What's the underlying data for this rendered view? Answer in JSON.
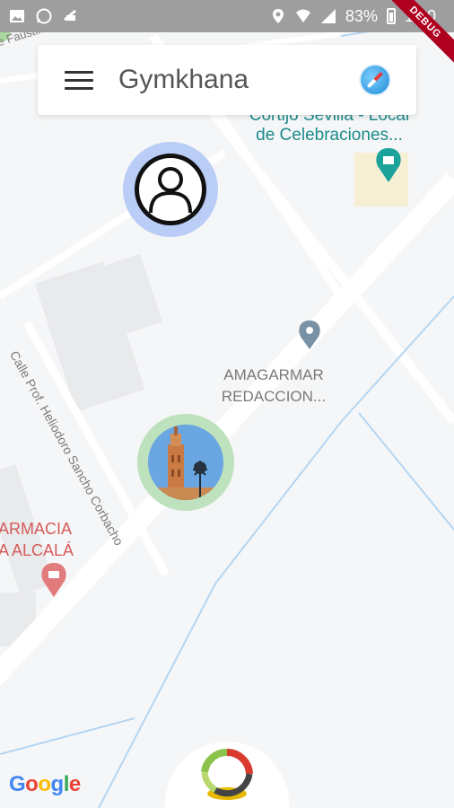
{
  "status_bar": {
    "battery": "83%",
    "time": "1:10",
    "debug": "DEBUG"
  },
  "app_bar": {
    "title": "Gymkhana",
    "menu_icon": "menu-icon",
    "compass_icon": "compass-icon"
  },
  "map": {
    "labels": {
      "street_top": "e Faustino Gutiérrez A",
      "poi_top_line1": "Cortijo Sevilla - Local",
      "poi_top_line2": "de Celebraciones...",
      "poi_mid_line1": "AMAGARMAR",
      "poi_mid_line2": "REDACCION...",
      "street_diag": "Calle Prof. Heliodoro Sancho Corbacho",
      "pharmacy_line1": "ARMACIA",
      "pharmacy_line2": "A ALCALÁ"
    },
    "markers": {
      "avatar": "person-icon",
      "photo": "giralda-photo"
    },
    "attribution": "Google"
  },
  "colors": {
    "accent_blue": "#b9cdf6",
    "accent_green": "#bde2bd",
    "poi_teal": "#1d8b8b",
    "poi_red": "#d65b5b"
  }
}
